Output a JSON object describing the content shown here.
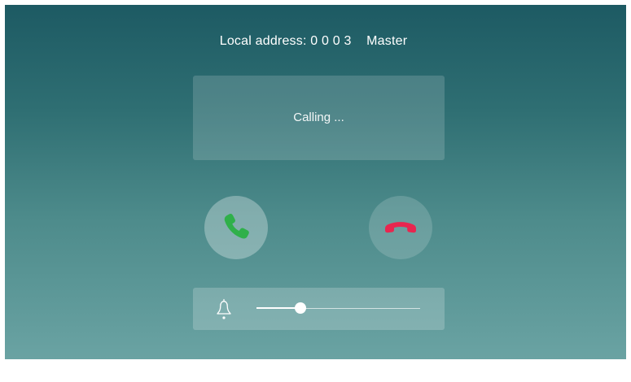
{
  "header": {
    "local_address": "Local address: 0 0 0 3    Master"
  },
  "status": {
    "text": "Calling ..."
  },
  "buttons": {
    "answer_icon": "phone-answer-icon",
    "hangup_icon": "phone-hangup-icon"
  },
  "volume": {
    "icon": "bell-icon",
    "level": 0.27
  },
  "colors": {
    "answer": "#2fb04a",
    "hangup": "#e8264f"
  }
}
